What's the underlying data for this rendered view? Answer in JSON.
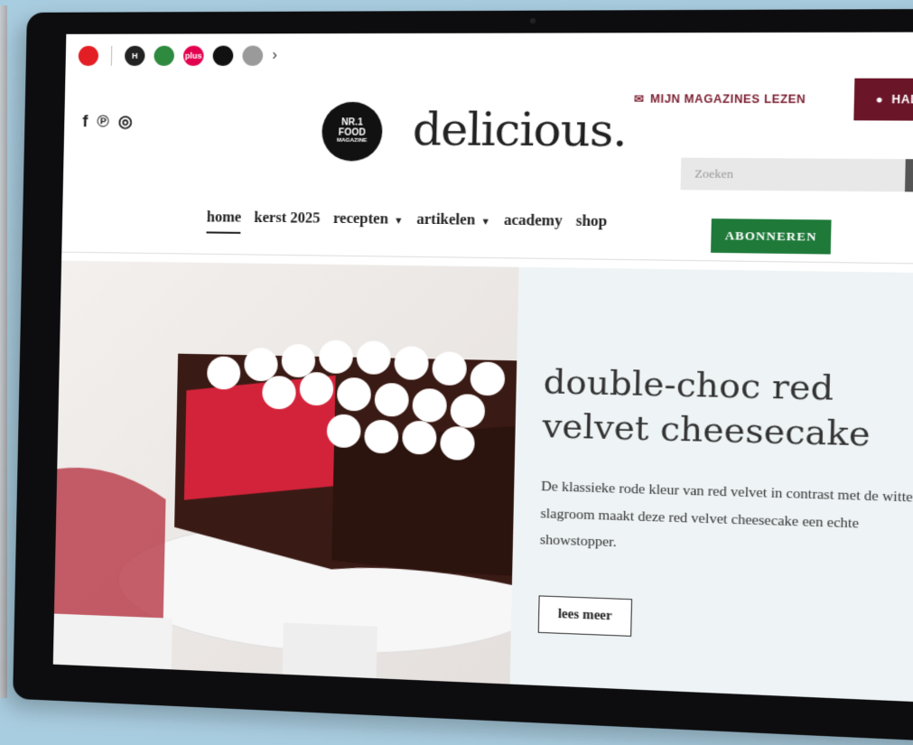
{
  "brand_bar": {
    "icons": [
      {
        "name": "red-brand-icon",
        "label": "",
        "color": "#e31e24"
      },
      {
        "name": "h-brand-icon",
        "label": "H",
        "color": "#222222"
      },
      {
        "name": "green-brand-icon",
        "label": "",
        "color": "#2d8a3e"
      },
      {
        "name": "plus-brand-icon",
        "label": "plus",
        "color": "#e3004f"
      },
      {
        "name": "dark-brand-icon",
        "label": "",
        "color": "#111111"
      },
      {
        "name": "grey-brand-icon",
        "label": "",
        "color": "#9a9a9a"
      }
    ],
    "more_icon": "›"
  },
  "header": {
    "magazines_label": "MIJN MAGAZINES LEZEN",
    "user_label": "HALLO ANOEK",
    "logo_badge_line1": "NR.1",
    "logo_badge_line2": "FOOD",
    "logo_badge_line3": "MAGAZINE",
    "logo_text": "delicious.",
    "search_placeholder": "Zoeken",
    "subscribe_label": "ABONNEREN"
  },
  "social": [
    "f",
    "℗",
    "◎"
  ],
  "nav": {
    "items": [
      {
        "label": "home",
        "active": true
      },
      {
        "label": "kerst 2025"
      },
      {
        "label": "recepten",
        "dropdown": true
      },
      {
        "label": "artikelen",
        "dropdown": true
      },
      {
        "label": "academy"
      },
      {
        "label": "shop"
      }
    ]
  },
  "hero": {
    "title": "double-choc red velvet cheesecake",
    "description": "De klassieke rode kleur van red velvet in contrast met de witte slagroom maakt deze red velvet cheesecake een echte showstopper.",
    "cta": "lees meer"
  },
  "colors": {
    "accent": "#6b1528",
    "subscribe": "#1f7a3a",
    "panel": "#eef3f5"
  }
}
